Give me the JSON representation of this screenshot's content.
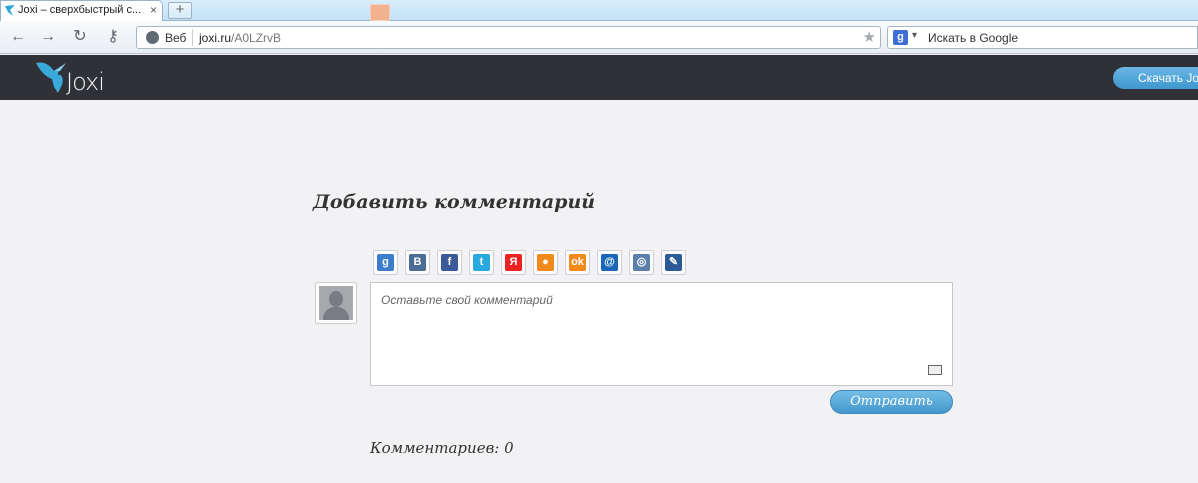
{
  "browser": {
    "tab_title": "Joxi – сверхбыстрый с...",
    "tab_close": "×",
    "newtab_symbol": "+",
    "nav": {
      "back_icon": "←",
      "forward_icon": "→",
      "reload_icon": "↻",
      "key_icon": "⚷"
    },
    "address": {
      "scheme_label": "Веб",
      "domain": "joxi.ru",
      "path": "/A0LZrvB",
      "star_icon": "★"
    },
    "search": {
      "engine_letter": "g",
      "caret": "▾",
      "placeholder": "Искать в Google"
    }
  },
  "site": {
    "logo_text": "Joxi",
    "download_label": "Скачать Jo"
  },
  "comments": {
    "title": "Добавить комментарий",
    "share": [
      {
        "name": "google",
        "glyph": "g",
        "color": "#3b7ccc"
      },
      {
        "name": "vk",
        "glyph": "B",
        "color": "#4a6c95"
      },
      {
        "name": "facebook",
        "glyph": "f",
        "color": "#3b5a98"
      },
      {
        "name": "twitter",
        "glyph": "t",
        "color": "#2aa8e0"
      },
      {
        "name": "yandex",
        "glyph": "Я",
        "color": "#e22"
      },
      {
        "name": "mail-agent",
        "glyph": "●",
        "color": "#f08a1c"
      },
      {
        "name": "odnoklassniki",
        "glyph": "ok",
        "color": "#f28a1a"
      },
      {
        "name": "mail",
        "glyph": "@",
        "color": "#1a66b8"
      },
      {
        "name": "openid",
        "glyph": "◎",
        "color": "#5b7fa8"
      },
      {
        "name": "livejournal",
        "glyph": "✎",
        "color": "#2b5a96"
      }
    ],
    "placeholder": "Оставьте свой комментарий",
    "send_label": "Отправить",
    "count_label": "Комментариев: 0"
  }
}
